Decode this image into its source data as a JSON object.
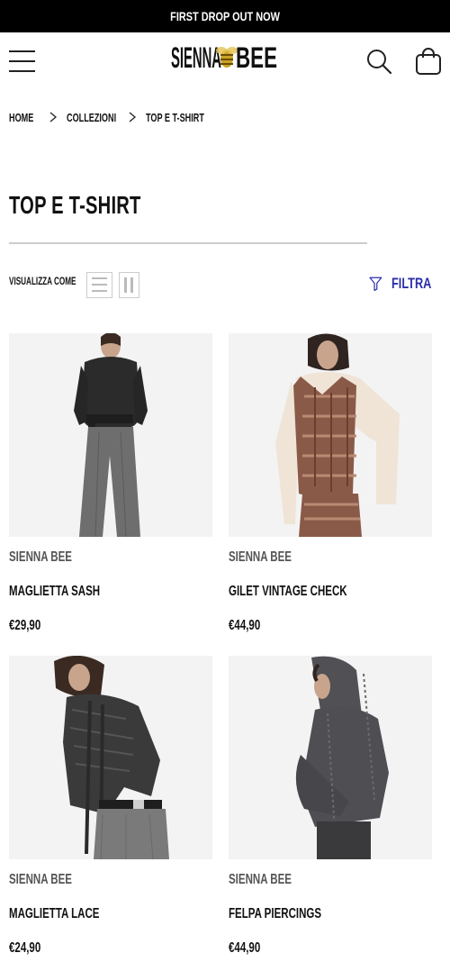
{
  "announcement": "FIRST DROP OUT NOW",
  "header": {
    "logo_text": "SIENNA BEE",
    "logo_left": "SIENNA",
    "logo_right": "BEE",
    "menu_icon": "hamburger-icon",
    "search_icon": "search-icon",
    "cart_icon": "shopping-bag-icon"
  },
  "breadcrumb": {
    "home": "HOME",
    "collections": "COLLEZIONI",
    "current": "TOP E T-SHIRT"
  },
  "page": {
    "title": "TOP E T-SHIRT"
  },
  "toolbar": {
    "view_label": "VISUALIZZA COME",
    "filter_label": "FILTRA",
    "filter_icon": "funnel-icon",
    "accent_color": "#2b2fa8"
  },
  "products": [
    {
      "brand": "SIENNA BEE",
      "name": "MAGLIETTA SASH",
      "price": "€29,90"
    },
    {
      "brand": "SIENNA BEE",
      "name": "GILET VINTAGE CHECK",
      "price": "€44,90"
    },
    {
      "brand": "SIENNA BEE",
      "name": "MAGLIETTA LACE",
      "price": "€24,90"
    },
    {
      "brand": "SIENNA BEE",
      "name": "FELPA PIERCINGS",
      "price": "€44,90"
    }
  ]
}
